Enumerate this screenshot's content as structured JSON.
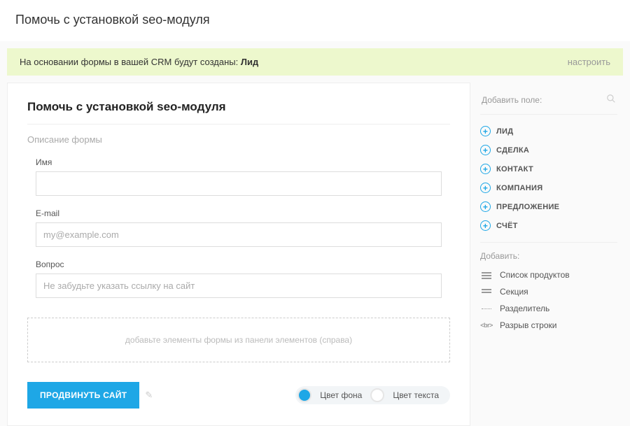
{
  "header": {
    "title": "Помочь с установкой seo-модуля"
  },
  "notice": {
    "prefix": "На основании формы в вашей CRM будут созданы: ",
    "entity": "Лид",
    "config": "настроить"
  },
  "form": {
    "title": "Помочь с установкой seo-модуля",
    "description": "Описание формы",
    "fields": [
      {
        "label": "Имя",
        "value": "",
        "placeholder": ""
      },
      {
        "label": "E-mail",
        "value": "",
        "placeholder": "my@example.com"
      },
      {
        "label": "Вопрос",
        "value": "",
        "placeholder": "Не забудьте указать ссылку на сайт"
      }
    ],
    "dropzone": "добавьте элементы формы из панели элементов (справа)",
    "submit": "ПРОДВИНУТЬ САЙТ",
    "bg_label": "Цвет фона",
    "text_label": "Цвет текста",
    "colors": {
      "bg": "#1ea7e6",
      "text": "#ffffff"
    }
  },
  "sidebar": {
    "add_field": "Добавить поле:",
    "entities": [
      {
        "label": "ЛИД"
      },
      {
        "label": "СДЕЛКА"
      },
      {
        "label": "КОНТАКТ"
      },
      {
        "label": "КОМПАНИЯ"
      },
      {
        "label": "ПРЕДЛОЖЕНИЕ"
      },
      {
        "label": "СЧЁТ"
      }
    ],
    "add_label": "Добавить:",
    "add_items": [
      {
        "label": "Список продуктов",
        "icon": "list-icon"
      },
      {
        "label": "Секция",
        "icon": "section-icon"
      },
      {
        "label": "Разделитель",
        "icon": "divider-icon"
      },
      {
        "label": "Разрыв строки",
        "icon": "br-icon"
      }
    ]
  }
}
